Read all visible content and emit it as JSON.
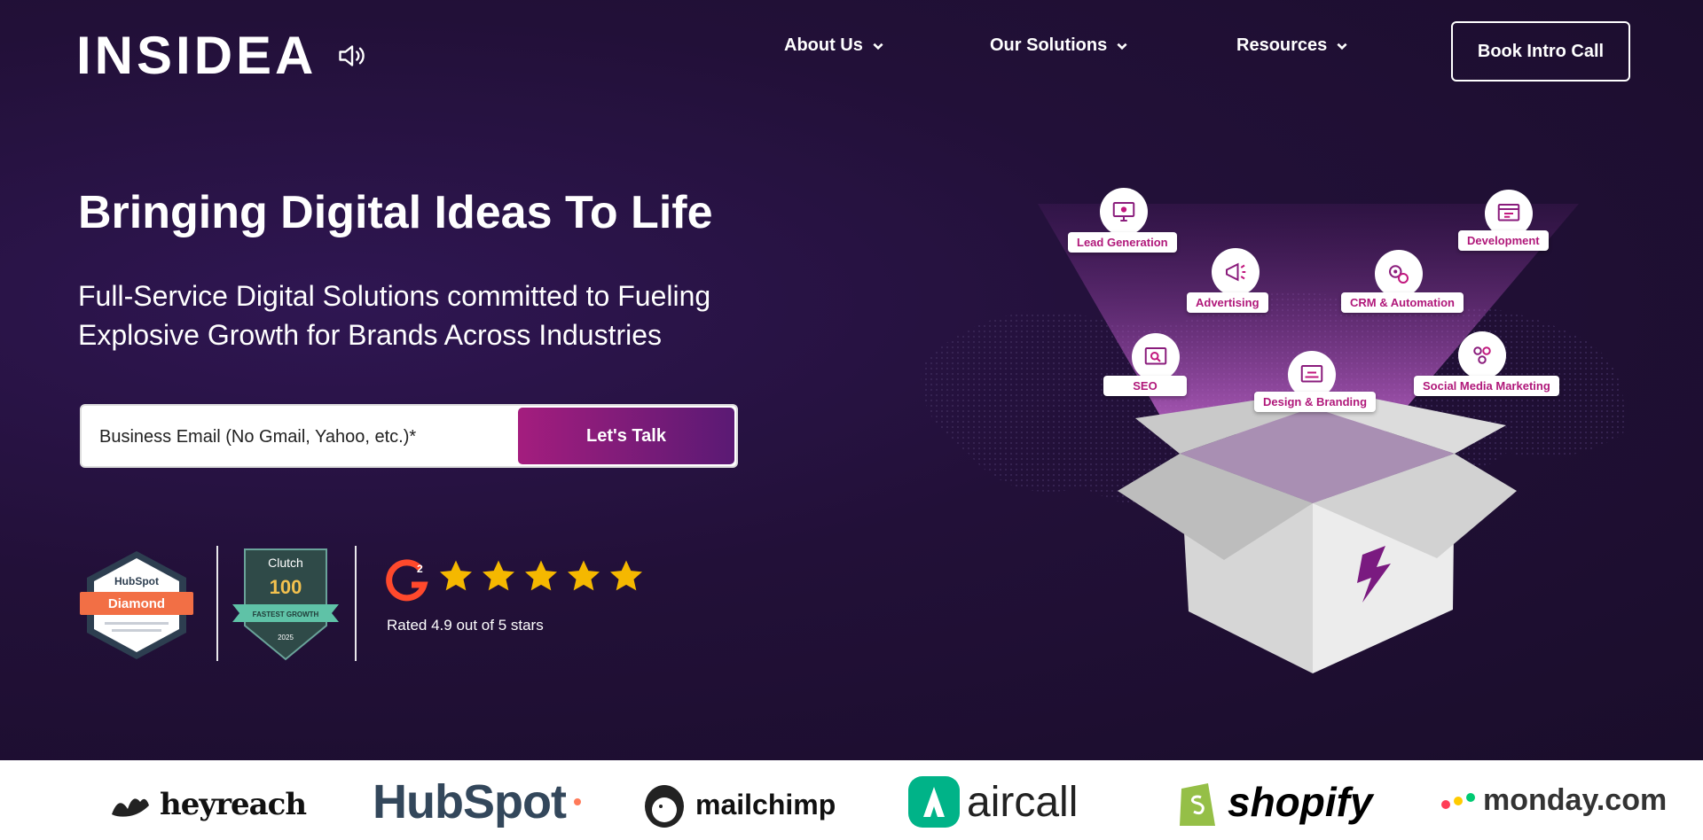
{
  "brand": {
    "logo": "INSIDEA"
  },
  "nav": {
    "items": [
      {
        "label": "About Us"
      },
      {
        "label": "Our Solutions"
      },
      {
        "label": "Resources"
      }
    ],
    "cta": "Book Intro Call"
  },
  "hero": {
    "headline": "Bringing Digital Ideas To Life",
    "subhead": "Full-Service Digital Solutions committed to Fueling Explosive Growth for Brands Across Industries",
    "email_placeholder": "Business Email (No Gmail, Yahoo, etc.)*",
    "submit_label": "Let's Talk"
  },
  "badges": {
    "hubspot": {
      "brand": "HubSpot",
      "tier": "Diamond"
    },
    "clutch": {
      "brand": "Clutch",
      "number": "100",
      "ribbon": "FASTEST GROWTH",
      "year": "2025"
    },
    "g2": {
      "logo": "G2",
      "stars": 5,
      "rating_text": "Rated 4.9 out of 5 stars"
    }
  },
  "services": [
    "Lead Generation",
    "Development",
    "Advertising",
    "CRM & Automation",
    "SEO",
    "Design & Branding",
    "Social Media Marketing"
  ],
  "partners": [
    "heyreach",
    "HubSpot",
    "mailchimp",
    "aircall",
    "shopify",
    "monday.com"
  ],
  "colors": {
    "accent": "#a41d7e",
    "accent_dark": "#5a1a74",
    "star": "#f5b800",
    "hero_bg": "#221038"
  }
}
